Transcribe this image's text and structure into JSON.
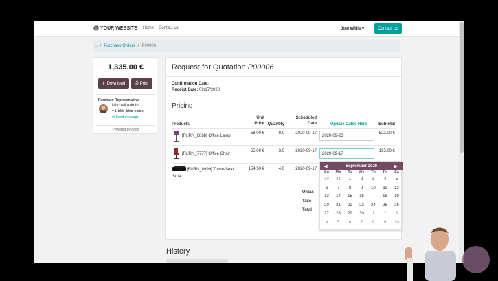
{
  "navbar": {
    "logo": "YOUR WEBSITE",
    "links": [
      "Home",
      "Contact us"
    ],
    "user": "Joel Willis",
    "contact_button": "Contact Us"
  },
  "breadcrumb": {
    "items": [
      "Purchase Orders",
      "P00006"
    ]
  },
  "sidebar": {
    "amount": "1,335.00 €",
    "download_label": "Download",
    "print_label": "Print",
    "rep_title": "Purchase Representative",
    "rep_name": "Mitchell Admin",
    "rep_phone": "+1 555-555-5555",
    "rep_message": "Send message",
    "powered_by": "Powered by odoo"
  },
  "document": {
    "title_prefix": "Request for Quotation",
    "title_ref": "P00006",
    "confirmation_label": "Confirmation Date:",
    "receipt_label": "Receipt Date:",
    "receipt_value": "09/17/2020",
    "pricing_heading": "Pricing",
    "columns": {
      "products": "Products",
      "unit_price_1": "Unit",
      "unit_price_2": "Price",
      "quantity": "Quantity",
      "scheduled_1": "Scheduled",
      "scheduled_2": "Date",
      "update_dates": "Update Dates Here",
      "subtotal": "Subtotal"
    },
    "rows": [
      {
        "product": "[FURN_8888] Office Lamp",
        "price": "58.00 €",
        "qty": "9.0",
        "scheduled": "2020-09-17",
        "date_input": "2020-09-23",
        "subtotal": "522.00 €"
      },
      {
        "product": "[FURN_7777] Office Chair",
        "price": "65.00 €",
        "qty": "3.0",
        "scheduled": "2020-09-17",
        "date_input": "2020-09-17",
        "subtotal": "195.00 €"
      },
      {
        "product": "[FURN_8999] Three-Seat",
        "product_2": "Sofa",
        "price": "154.50 €",
        "qty": "4.0",
        "scheduled": "2020-09-17"
      }
    ],
    "totals": {
      "untaxed": "Untax",
      "taxes": "Taxe",
      "total": "Total"
    }
  },
  "calendar": {
    "month": "September 2020",
    "dow": [
      "Su",
      "Mo",
      "Tu",
      "We",
      "Th",
      "Fr",
      "Sa"
    ],
    "weeks": [
      [
        "30",
        "31",
        "1",
        "2",
        "3",
        "4",
        "5"
      ],
      [
        "6",
        "7",
        "8",
        "9",
        "10",
        "11",
        "12"
      ],
      [
        "13",
        "14",
        "15",
        "16",
        "17",
        "18",
        "19"
      ],
      [
        "20",
        "21",
        "22",
        "23",
        "24",
        "25",
        "26"
      ],
      [
        "27",
        "28",
        "29",
        "30",
        "1",
        "2",
        "3"
      ],
      [
        "4",
        "5",
        "6",
        "7",
        "8",
        "9",
        "10"
      ]
    ],
    "selected": "17",
    "accent": "#75495f",
    "highlight": "#00a09d"
  },
  "history": {
    "heading": "History"
  }
}
